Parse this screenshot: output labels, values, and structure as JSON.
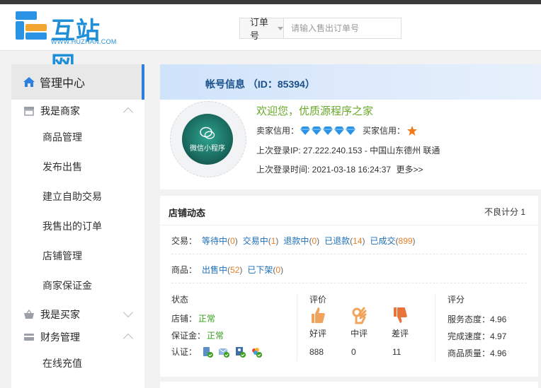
{
  "header": {
    "logo_text": "互站网",
    "logo_sub": "WWW.HUZHAN.COM",
    "search_select": "订单号",
    "search_placeholder": "请输入售出订单号"
  },
  "sidebar": {
    "title": "管理中心",
    "groups": [
      {
        "label": "我是商家",
        "items": [
          "商品管理",
          "发布出售",
          "建立自助交易",
          "我售出的订单",
          "店铺管理",
          "商家保证金"
        ]
      },
      {
        "label": "我是买家",
        "items": []
      },
      {
        "label": "财务管理",
        "items": [
          "在线充值"
        ]
      }
    ]
  },
  "profile": {
    "title": "帐号信息 （ID：85394）",
    "avatar_label": "微信小程序",
    "welcome": "欢迎您，优质源程序之家",
    "seller_credit_label": "卖家信用：",
    "buyer_credit_label": "买家信用：",
    "seller_diamonds": 5,
    "buyer_stars": 1,
    "last_ip": "上次登录IP: 27.222.240.153 - 中国山东德州 联通",
    "last_time": "上次登录时间: 2021-03-18 16:24:37",
    "more": "更多>>"
  },
  "shop": {
    "title": "店铺动态",
    "bad_score": "不良计分 1",
    "trade_label": "交易：",
    "trade": [
      {
        "label": "等待中",
        "count": "0"
      },
      {
        "label": "交易中",
        "count": "1"
      },
      {
        "label": "退款中",
        "count": "0"
      },
      {
        "label": "已退款",
        "count": "14"
      },
      {
        "label": "已成交",
        "count": "899"
      }
    ],
    "goods_label": "商品：",
    "goods": [
      {
        "label": "出售中",
        "count": "52"
      },
      {
        "label": "已下架",
        "count": "0"
      }
    ],
    "status": {
      "title": "状态",
      "store_label": "店铺：",
      "store_value": "正常",
      "deposit_label": "保证金：",
      "deposit_value": "正常",
      "cert_label": "认证："
    },
    "review": {
      "title": "评价",
      "good": "好评",
      "mid": "中评",
      "bad": "差评",
      "good_count": "888",
      "mid_count": "0",
      "bad_count": "11"
    },
    "score": {
      "title": "评分",
      "service": "服务态度：4.96",
      "speed": "完成速度：4.97",
      "quality": "商品质量：4.96"
    }
  },
  "colors": {
    "accent": "#2d7fe0",
    "link": "#1e6fb8",
    "count": "#e67e22",
    "welcome": "#6aa82a",
    "ok": "#3aa020"
  }
}
